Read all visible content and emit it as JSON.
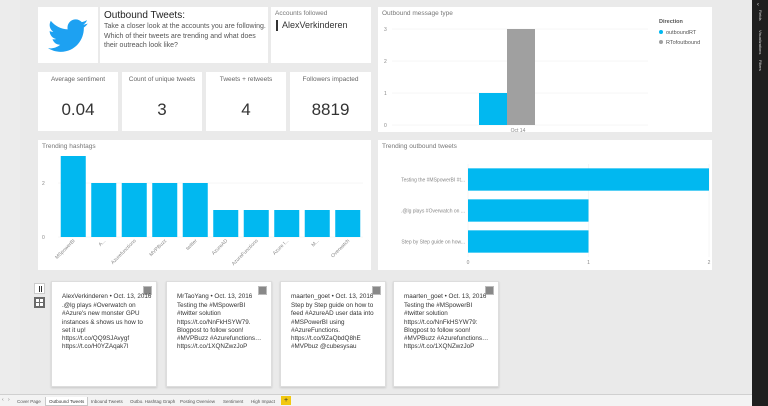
{
  "header": {
    "title": "Outbound Tweets:",
    "description": "Take a closer look at the accounts you are following. Which of their tweets are trending and what does their outreach look like?"
  },
  "accounts_followed": {
    "label": "Accounts followed",
    "value": "AlexVerkinderen"
  },
  "cards": [
    {
      "label": "Average sentiment",
      "value": "0.04"
    },
    {
      "label": "Count of unique tweets",
      "value": "3"
    },
    {
      "label": "Tweets + retweets",
      "value": "4"
    },
    {
      "label": "Followers impacted",
      "value": "8819"
    }
  ],
  "charts": {
    "message_type": {
      "title": "Outbound message type",
      "legend_title": "Direction",
      "legend": [
        "outboundRT",
        "RTofoutbound"
      ],
      "x_label": "Oct 14"
    },
    "hashtags": {
      "title": "Trending hashtags"
    },
    "trending_tweets": {
      "title": "Trending outbound tweets"
    }
  },
  "chart_data": [
    {
      "type": "bar",
      "title": "Outbound message type",
      "categories": [
        "Oct 14"
      ],
      "series": [
        {
          "name": "outboundRT",
          "values": [
            1
          ]
        },
        {
          "name": "RTofoutbound",
          "values": [
            3
          ]
        }
      ],
      "ylim": [
        0,
        3
      ],
      "yticks": [
        0,
        1,
        2,
        3
      ],
      "legend": "top-right"
    },
    {
      "type": "bar",
      "title": "Trending hashtags",
      "categories": [
        "MSpowerBI",
        "A...",
        "Azurefunctions",
        "MVPBuzz",
        "twitter",
        "AzureAD",
        "AzureFunctions",
        "Azure I...",
        "M...",
        "Overwatch"
      ],
      "values": [
        3,
        2,
        2,
        2,
        2,
        1,
        1,
        1,
        1,
        1
      ],
      "ylim": [
        0,
        3
      ],
      "yticks": [
        0,
        2
      ]
    },
    {
      "type": "bar",
      "orientation": "horizontal",
      "title": "Trending outbound tweets",
      "categories": [
        "Testing the #MSpowerBI #t...",
        ".@lg plays #Overwatch on ...",
        "Step by Step guide on how..."
      ],
      "values": [
        2,
        1,
        1
      ],
      "xlim": [
        0,
        2
      ],
      "xticks": [
        0,
        1,
        2
      ]
    }
  ],
  "tweets": [
    {
      "head": "AlexVerkinderen • Oct. 13, 2016",
      "text": ".@lg plays #Overwatch on #Azure's new monster GPU instances & shows us how to set it up!\nhttps://t.co/QQ9SJAvygf https://t.co/H0YZAqak7l"
    },
    {
      "head": "MrTaoYang • Oct. 13, 2016",
      "text": "Testing the #MSpowerBI #twitter solution\nhttps://t.co/NnFkHSYW79. Blogpost to follow soon!\n#MVPBuzz #Azurefunctions… https://t.co/1XQNZwzJoP"
    },
    {
      "head": "maarten_goet • Oct. 13, 2016",
      "text": "Step by Step guide on how to feed #AzureAD user data into #MSPowerBI using #AzureFunctions.\nhttps://t.co/9ZaQbdQ8hE #MVPbuz @cubesysau"
    },
    {
      "head": "maarten_goet • Oct. 13, 2016",
      "text": "Testing the #MSpowerBI #twitter solution https://t.co/NnFkHSYW79: Blogpost to follow soon!\n#MVPBuzz #Azurefunctions… https://t.co/1XQNZwzJoP"
    }
  ],
  "tabs": [
    "Cover Page",
    "Outbound Tweets",
    "Inbound Tweets",
    "Outbo. Hashtag Graph",
    "Posting Overview",
    "Sentiment",
    "High Impact"
  ],
  "active_tab": "Outbound Tweets",
  "right_pane": [
    "Fields",
    "Visualizations",
    "Filters"
  ],
  "colors": {
    "accent": "#01b8f0",
    "secondary": "#a0a0a0",
    "twitter": "#1da1f2",
    "tab_add": "#f2c811"
  },
  "icons": [
    "twitter-logo-icon",
    "tab-nav-left-icon",
    "tab-nav-right-icon",
    "list-view-icon",
    "grid-view-icon",
    "add-tab-icon"
  ]
}
